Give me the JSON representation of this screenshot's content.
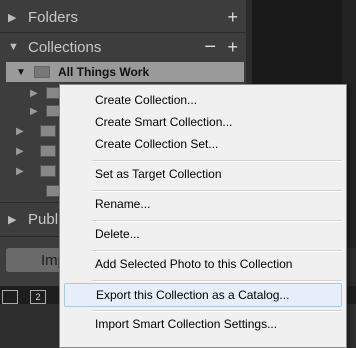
{
  "left_panel": {
    "folders": {
      "label": "Folders",
      "add": "+"
    },
    "collections": {
      "label": "Collections",
      "remove": "−",
      "add": "+"
    },
    "selected_collection": "All Things Work",
    "publish_label": "Publi",
    "import_label": "Imp",
    "page_numbers": [
      "",
      "2"
    ]
  },
  "context_menu": {
    "items": [
      "Create Collection...",
      "Create Smart Collection...",
      "Create Collection Set...",
      "Set as Target Collection",
      "Rename...",
      "Delete...",
      "Add Selected Photo to this Collection",
      "Export this Collection as a Catalog...",
      "Import Smart Collection Settings..."
    ],
    "highlighted_index": 7
  },
  "colors": {
    "panel": "#3d3d3d",
    "menu_bg": "#f0f0f0",
    "hover_bg": "#e5eef9",
    "hover_border": "#a8c8ec",
    "selected_row": "#9a9a9a"
  }
}
